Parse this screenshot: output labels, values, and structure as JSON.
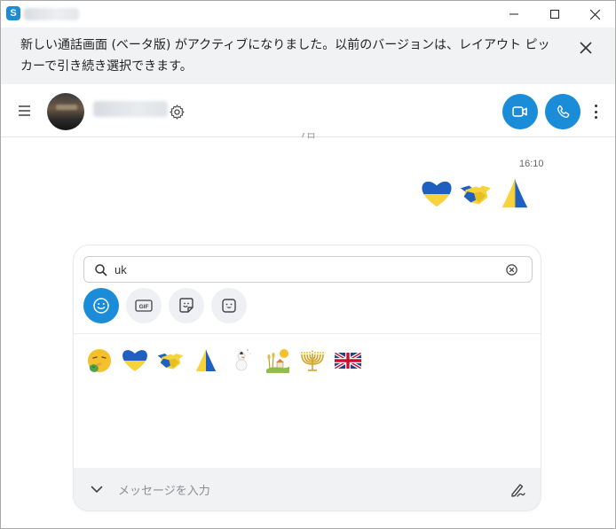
{
  "window": {
    "controls": [
      "minimize-icon",
      "maximize-icon",
      "close-icon"
    ]
  },
  "banner": {
    "text": "新しい通話画面 (ベータ版) がアクティブになりました。以前のバージョンは、レイアウト ピッカーで引き続き選択できます。",
    "close_icon": "close-icon"
  },
  "header": {
    "icons": [
      "hamburger-menu-icon",
      "avatar",
      "gear-icon",
      "video-call-icon",
      "phone-call-icon",
      "more-vertical-icon"
    ]
  },
  "chat": {
    "cut_text": "7日",
    "message": {
      "time": "16:10",
      "emojis": [
        "blue-yellow-heart-emoji",
        "handshake-emoji",
        "praying-hands-emoji"
      ]
    }
  },
  "picker": {
    "search": {
      "value": "uk",
      "placeholder": ""
    },
    "tabs": [
      {
        "name": "emoji-tab",
        "icon": "smiley-icon",
        "label": ""
      },
      {
        "name": "gif-tab",
        "icon": "gif-icon",
        "label": "GIF"
      },
      {
        "name": "sticker-tab",
        "icon": "sticker-icon",
        "label": ""
      },
      {
        "name": "moji-tab",
        "icon": "moji-icon",
        "label": ""
      }
    ],
    "results": [
      "money-mouth-face-emoji",
      "blue-yellow-heart-emoji",
      "handshake-emoji",
      "praying-hands-emoji",
      "snowman-emoji",
      "wheat-field-emoji",
      "menorah-emoji",
      "union-jack-flag-emoji"
    ]
  },
  "compose": {
    "placeholder": "メッセージを入力",
    "icons": [
      "chevron-down-icon",
      "pen-icon"
    ]
  },
  "colors": {
    "accent": "#1a8cd8",
    "banner_bg": "#f1f2f4",
    "ukraine_blue": "#1f5fbf",
    "ukraine_yellow": "#f6d23c"
  }
}
